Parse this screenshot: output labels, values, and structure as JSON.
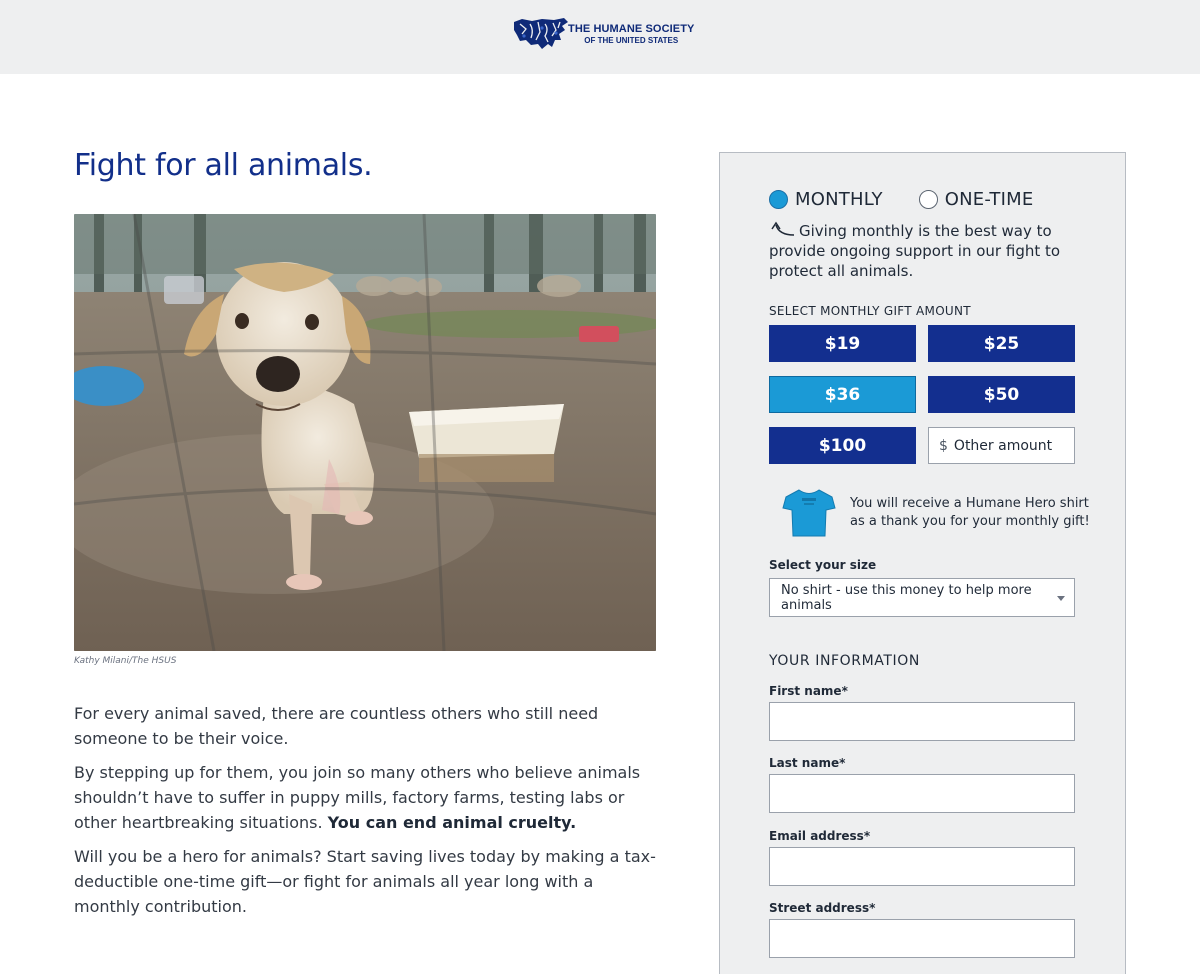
{
  "header": {
    "org_name_line1": "THE HUMANE SOCIETY",
    "org_name_line2": "OF THE UNITED STATES"
  },
  "main": {
    "headline": "Fight for all animals.",
    "photo_caption": "Kathy Milani/The HSUS",
    "paragraphs": [
      "For every animal saved, there are countless others who still need someone to be their voice.",
      "By stepping up for them, you join so many others who believe animals shouldn’t have to suffer in puppy mills, factory farms, testing labs or other heartbreaking situations.",
      "Will you be a hero for animals? Start saving lives today by making a tax-deductible one-time gift—or fight for animals all year long with a monthly contribution."
    ],
    "emphasis": "You can end animal cruelty."
  },
  "donation": {
    "frequency": {
      "monthly_label": "MONTHLY",
      "onetime_label": "ONE-TIME",
      "selected": "monthly"
    },
    "hint": "Giving monthly is the best way to provide ongoing support in our fight to protect all animals.",
    "amount_title": "SELECT MONTHLY GIFT AMOUNT",
    "amounts": [
      "$19",
      "$25",
      "$36",
      "$50",
      "$100"
    ],
    "selected_amount": "$36",
    "other_currency": "$",
    "other_placeholder": "Other amount",
    "shirt_message": "You will receive a Humane Hero shirt as a thank you for your monthly gift!",
    "size_label": "Select your size",
    "size_selected": "No shirt - use this money to help more animals",
    "info_title": "YOUR INFORMATION",
    "fields": {
      "first_name": "First name*",
      "last_name": "Last name*",
      "email": "Email address*",
      "street": "Street address*"
    }
  },
  "colors": {
    "brand_navy": "#132f8f",
    "selected_blue": "#1b9ad6",
    "panel_bg": "#eeeff0",
    "headline": "#122f8a"
  },
  "icons": {
    "logo": "us-map-animals-logo",
    "hint_arrow": "curved-arrow-icon",
    "shirt": "tshirt-icon",
    "caret": "caret-down-icon"
  }
}
